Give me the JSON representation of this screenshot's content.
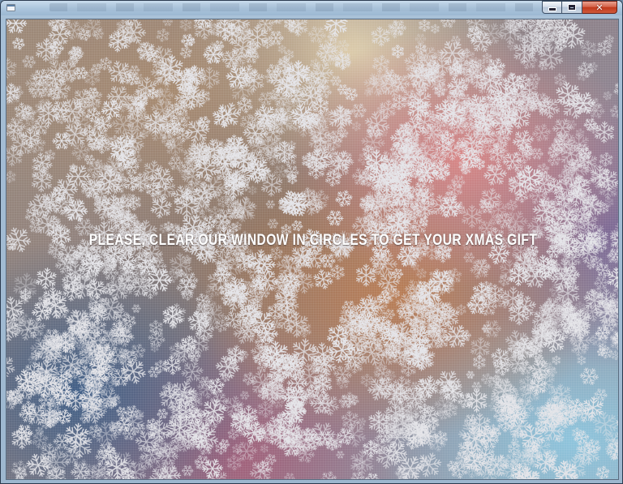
{
  "window": {
    "title": "",
    "icons": {
      "app": "app-window-icon",
      "minimize": "minimize-icon",
      "maximize": "maximize-icon",
      "close": "close-icon"
    },
    "close_glyph": "✕"
  },
  "scene": {
    "message": "PLEASE, CLEAR OUR WINDOW IN CIRCLES TO GET YOUR XMAS GIFT",
    "colors": {
      "frost": "#e6e6ea",
      "message": "#ffffff"
    }
  }
}
